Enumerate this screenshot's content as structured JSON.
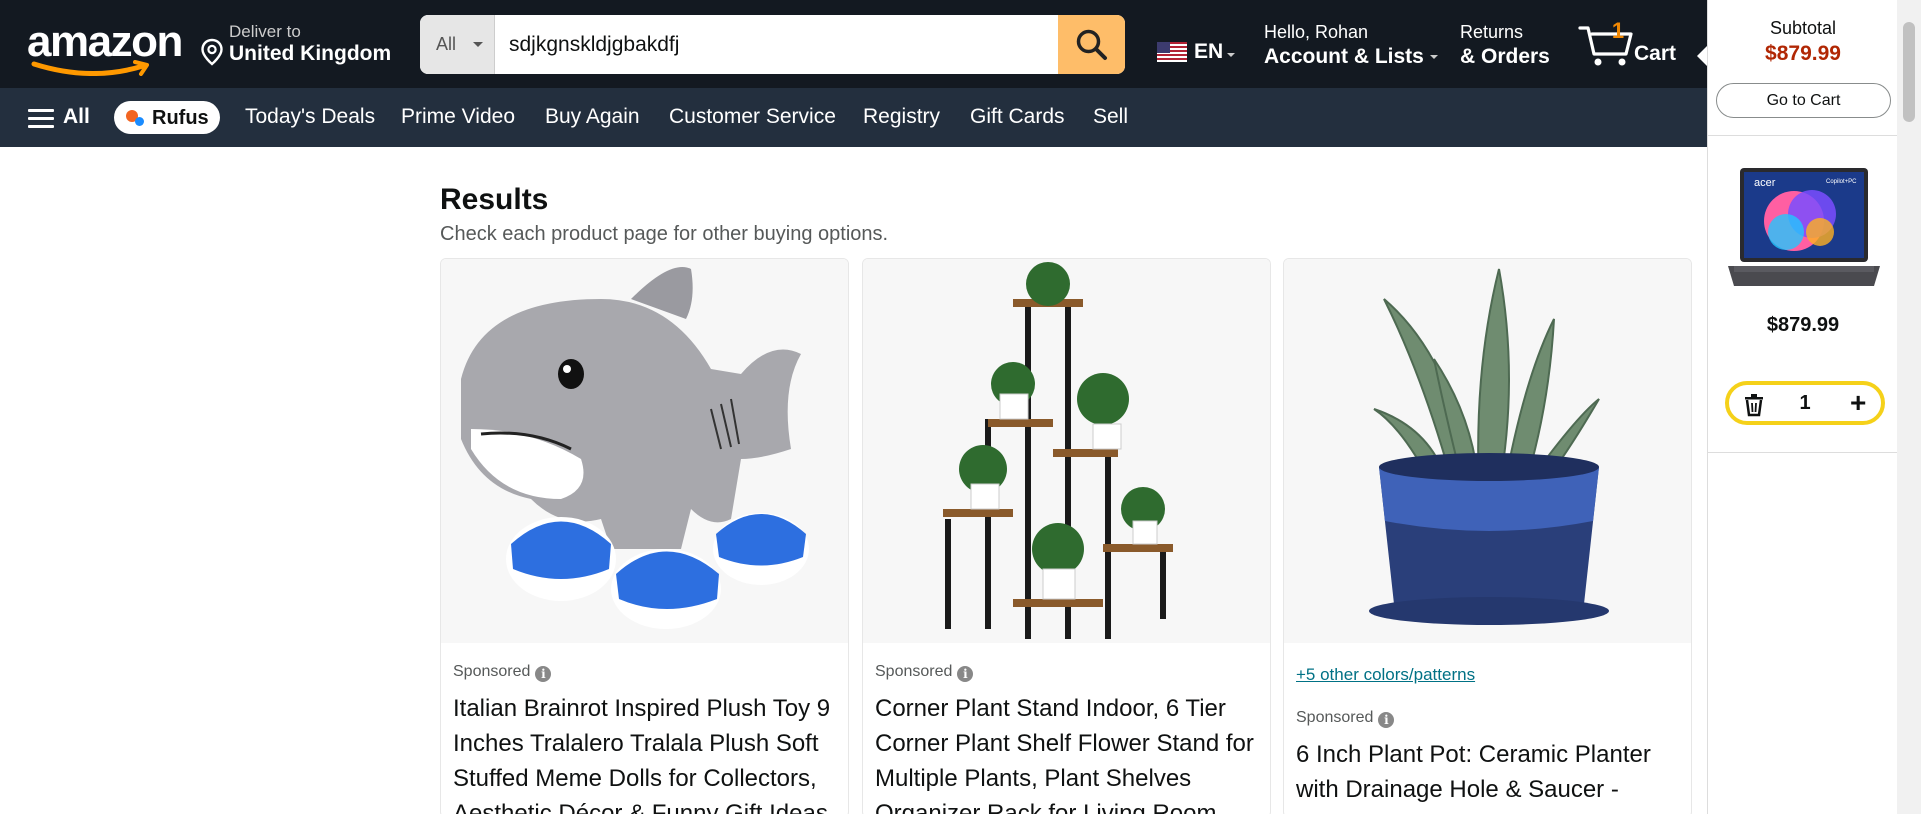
{
  "header": {
    "logo_text": "amazon",
    "deliver_line1": "Deliver to",
    "deliver_line2": "United Kingdom",
    "search_category": "All",
    "search_value": "sdjkgnskldjgbakdfj",
    "language": "EN",
    "account_line1": "Hello, Rohan",
    "account_line2": "Account & Lists",
    "returns_line1": "Returns",
    "returns_line2": "& Orders",
    "cart_count": "1",
    "cart_label": "Cart"
  },
  "subnav": {
    "all_label": "All",
    "rufus_label": "Rufus",
    "items": [
      "Today's Deals",
      "Prime Video",
      "Buy Again",
      "Customer Service",
      "Registry",
      "Gift Cards",
      "Sell"
    ]
  },
  "main": {
    "results_title": "Results",
    "results_subtitle": "Check each product page for other buying options.",
    "cards": [
      {
        "sponsored": "Sponsored",
        "title": "Italian Brainrot Inspired Plush Toy 9 Inches Tralalero Tralala Plush Soft Stuffed Meme Dolls for Collectors, Aesthetic Décor & Funny Gift Ideas"
      },
      {
        "sponsored": "Sponsored",
        "title": "Corner Plant Stand Indoor, 6 Tier Corner Plant Shelf Flower Stand for Multiple Plants, Plant Shelves Organizer Rack for Living Room"
      },
      {
        "colors_link": "+5 other colors/patterns",
        "sponsored": "Sponsored",
        "title": "6 Inch Plant Pot: Ceramic Planter with Drainage Hole & Saucer -"
      }
    ]
  },
  "cart_flyout": {
    "subtotal_label": "Subtotal",
    "subtotal_value": "$879.99",
    "go_to_cart": "Go to Cart",
    "item_price": "$879.99",
    "item_qty": "1",
    "laptop_brand": "acer",
    "laptop_badge": "Copilot+PC"
  },
  "colors": {
    "nav_top": "#131921",
    "nav_sub": "#232f3e",
    "search_button": "#febd69",
    "price_red": "#b12704",
    "link_teal": "#007185",
    "cart_count": "#f08804",
    "qty_border": "#f5d119"
  }
}
